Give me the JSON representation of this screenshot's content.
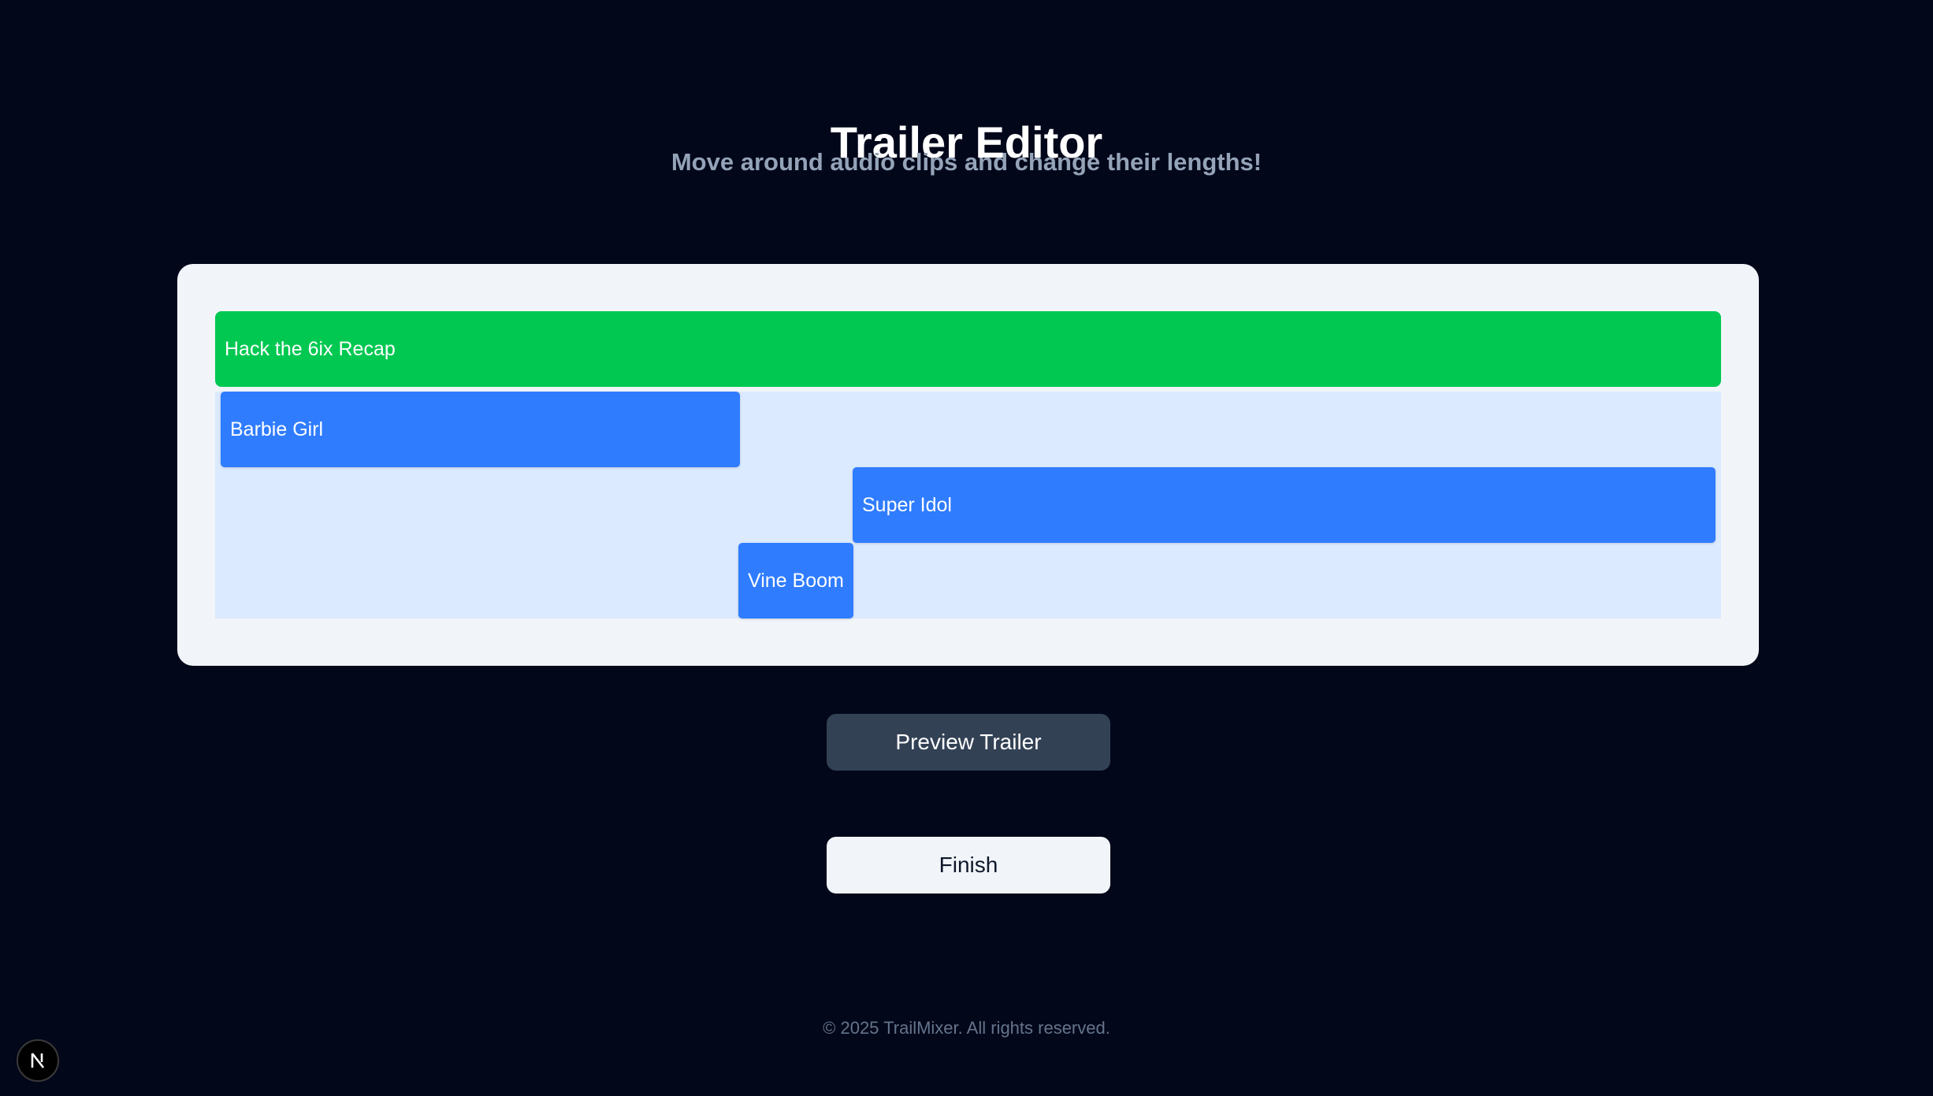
{
  "header": {
    "title": "Trailer Editor",
    "subtitle": "Move around audio clips and change their lengths!"
  },
  "timeline": {
    "main_track": {
      "label": "Hack the 6ix Recap",
      "color": "#00c851"
    },
    "clip_color": "#2f7cff",
    "lane_color": "#dbeafe",
    "clips": [
      {
        "label": "Barbie Girl"
      },
      {
        "label": "Super Idol"
      },
      {
        "label": "Vine Boom"
      }
    ]
  },
  "actions": {
    "preview_label": "Preview Trailer",
    "finish_label": "Finish"
  },
  "footer": {
    "text": "© 2025 TrailMixer. All rights reserved."
  },
  "dev_badge": {
    "icon": "nextjs-logo-icon"
  },
  "colors": {
    "background": "#03071a",
    "panel": "#f1f5f9",
    "preview_button": "#334155"
  }
}
